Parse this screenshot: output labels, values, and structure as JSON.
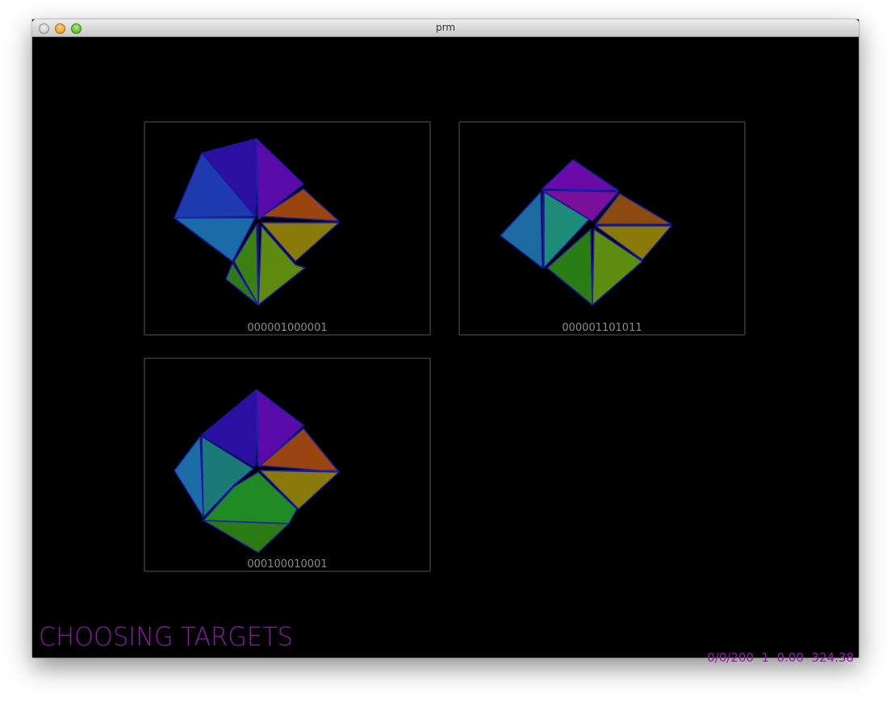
{
  "window": {
    "title": "prm"
  },
  "panels": [
    {
      "label": "000001000001"
    },
    {
      "label": "000001101011"
    },
    {
      "label": "000100010001"
    }
  ],
  "status": {
    "mode": "CHOOSING  TARGETS",
    "stats": "0/0/200  1  0.00  324.38"
  },
  "colors": {
    "background": "#000000",
    "status_text": "#9a18b4",
    "panel_border": "#2c2c2c",
    "panel_label": "#8a8a8a",
    "edge": "#1a1aa0"
  },
  "icons": {
    "close": "close-button-icon",
    "minimize": "minimize-button-icon",
    "zoom": "zoom-button-icon"
  }
}
